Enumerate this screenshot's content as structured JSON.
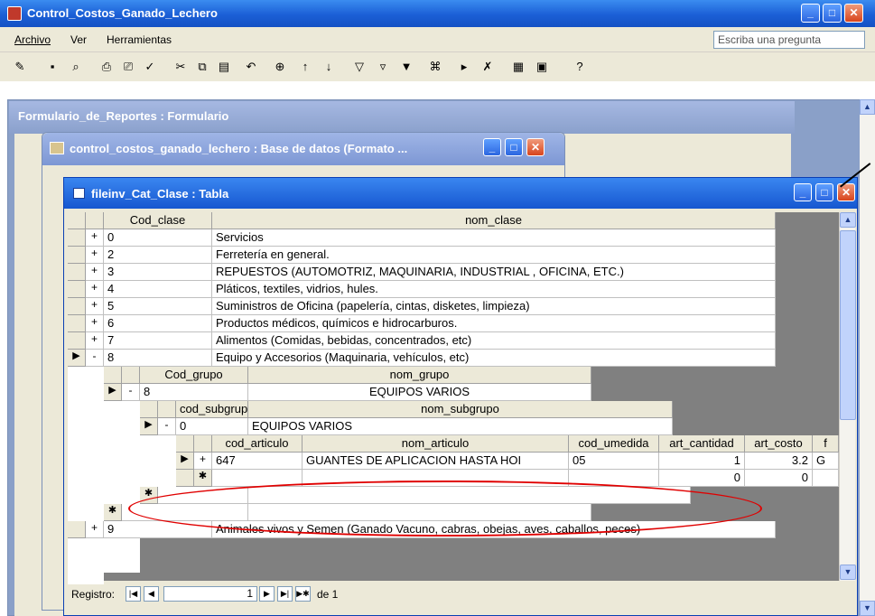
{
  "app": {
    "title": "Control_Costos_Ganado_Lechero"
  },
  "menu": {
    "items": [
      "Archivo",
      "Ver",
      "Herramientas"
    ],
    "ask_placeholder": "Escriba una pregunta"
  },
  "form_window": {
    "title": "Formulario_de_Reportes : Formulario"
  },
  "db_window": {
    "title": "control_costos_ganado_lechero : Base de datos (Formato ..."
  },
  "table_window": {
    "title": "fileinv_Cat_Clase : Tabla",
    "headers": {
      "cod_clase": "Cod_clase",
      "nom_clase": "nom_clase"
    },
    "rows": [
      {
        "expander": "+",
        "code": "0",
        "name": "Servicios"
      },
      {
        "expander": "+",
        "code": "2",
        "name": "Ferretería en general."
      },
      {
        "expander": "+",
        "code": "3",
        "name": "REPUESTOS (AUTOMOTRIZ, MAQUINARIA, INDUSTRIAL , OFICINA, ETC.)"
      },
      {
        "expander": "+",
        "code": "4",
        "name": "Pláticos, textiles, vidrios, hules."
      },
      {
        "expander": "+",
        "code": "5",
        "name": "Suministros de Oficina (papelería, cintas, disketes, limpieza)"
      },
      {
        "expander": "+",
        "code": "6",
        "name": "Productos médicos, químicos e hidrocarburos."
      },
      {
        "expander": "+",
        "code": "7",
        "name": "Alimentos (Comidas, bebidas, concentrados, etc)"
      },
      {
        "expander": "-",
        "code": "8",
        "name": "Equipo y Accesorios (Maquinaria, vehículos, etc)",
        "current": true
      }
    ],
    "grupo": {
      "headers": {
        "cod_grupo": "Cod_grupo",
        "nom_grupo": "nom_grupo"
      },
      "row": {
        "expander": "-",
        "code": "8",
        "name": "EQUIPOS VARIOS"
      }
    },
    "subgrupo": {
      "headers": {
        "cod_subgrupo": "cod_subgrupo",
        "nom_subgrupo": "nom_subgrupo"
      },
      "row": {
        "expander": "-",
        "code": "0",
        "name": "EQUIPOS VARIOS"
      }
    },
    "articulo": {
      "headers": {
        "cod_articulo": "cod_articulo",
        "nom_articulo": "nom_articulo",
        "cod_umedida": "cod_umedida",
        "art_cantidad": "art_cantidad",
        "art_costo": "art_costo",
        "extra": "f"
      },
      "row": {
        "expander": "+",
        "code": "647",
        "name": "GUANTES DE APLICACION HASTA HOI",
        "umedida": "05",
        "cantidad": "1",
        "costo": "3.2",
        "extra": "G"
      },
      "new_row": {
        "cantidad": "0",
        "costo": "0"
      }
    },
    "row9": {
      "expander": "+",
      "code": "9",
      "name": "Animales vivos y Semen (Ganado Vacuno, cabras, obejas, aves, caballos, peces)"
    },
    "nav": {
      "label": "Registro:",
      "current": "1",
      "total_label": "de 1"
    }
  }
}
